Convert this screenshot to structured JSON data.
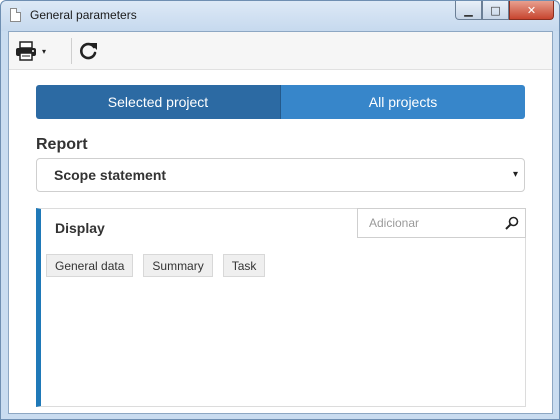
{
  "window": {
    "title": "General parameters",
    "controls": {
      "minimize": "▁",
      "maximize": "□",
      "close": "✕"
    }
  },
  "toolbar": {
    "print_icon": "printer-icon",
    "print_caret": "▾",
    "refresh_icon": "refresh-icon"
  },
  "tabs": [
    {
      "label": "Selected project",
      "active": true
    },
    {
      "label": "All projects",
      "active": false
    }
  ],
  "report": {
    "label": "Report",
    "selected": "Scope statement",
    "caret": "▾"
  },
  "display": {
    "title": "Display",
    "search_placeholder": "Adicionar",
    "items": [
      {
        "label": "General data"
      },
      {
        "label": "Summary"
      },
      {
        "label": "Task"
      }
    ]
  },
  "colors": {
    "tab_active": "#2c6aa3",
    "tab_inactive": "#3786ca",
    "panel_accent": "#1f79b8"
  }
}
